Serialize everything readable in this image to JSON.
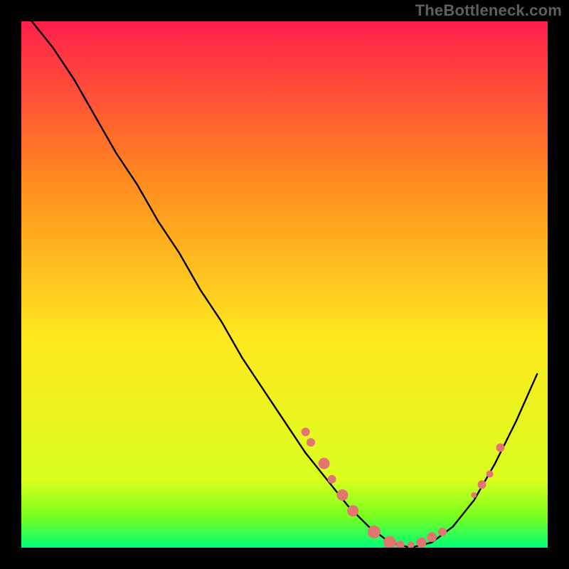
{
  "watermark": "TheBottleneck.com",
  "chart_data": {
    "type": "line",
    "title": "",
    "xlabel": "",
    "ylabel": "",
    "xlim": [
      0,
      100
    ],
    "ylim": [
      0,
      100
    ],
    "grid": false,
    "legend": false,
    "background_gradient": {
      "top": "#ff1f4b",
      "mid_upper": "#ff8a1f",
      "mid": "#ffe81f",
      "lower": "#7aff1f",
      "bottom": "#00ff7a"
    },
    "series": [
      {
        "name": "bottleneck_curve",
        "x": [
          2,
          6,
          10,
          14,
          18,
          22,
          26,
          30,
          34,
          38,
          42,
          46,
          50,
          54,
          58,
          62,
          66,
          70,
          74,
          78,
          82,
          86,
          90,
          94,
          98
        ],
        "y": [
          100,
          95,
          89,
          82,
          75,
          69,
          62,
          56,
          49,
          43,
          36,
          30,
          24,
          18,
          13,
          8,
          4,
          1,
          0,
          1,
          4,
          9,
          16,
          24,
          33
        ]
      }
    ],
    "markers": [
      {
        "x": 54,
        "y": 22,
        "r": 6
      },
      {
        "x": 55,
        "y": 20,
        "r": 6
      },
      {
        "x": 57.5,
        "y": 16,
        "r": 8
      },
      {
        "x": 59,
        "y": 13,
        "r": 6
      },
      {
        "x": 61,
        "y": 10,
        "r": 8
      },
      {
        "x": 63,
        "y": 7,
        "r": 8
      },
      {
        "x": 67,
        "y": 3,
        "r": 9
      },
      {
        "x": 70,
        "y": 1,
        "r": 9
      },
      {
        "x": 72,
        "y": 0.5,
        "r": 6
      },
      {
        "x": 74,
        "y": 0.5,
        "r": 5
      },
      {
        "x": 76,
        "y": 1,
        "r": 7
      },
      {
        "x": 78,
        "y": 2,
        "r": 7
      },
      {
        "x": 80,
        "y": 3,
        "r": 6
      },
      {
        "x": 86,
        "y": 10,
        "r": 4
      },
      {
        "x": 87.5,
        "y": 12,
        "r": 6
      },
      {
        "x": 89,
        "y": 14,
        "r": 5
      },
      {
        "x": 91,
        "y": 19,
        "r": 6
      }
    ],
    "marker_color": "#e2766e"
  }
}
